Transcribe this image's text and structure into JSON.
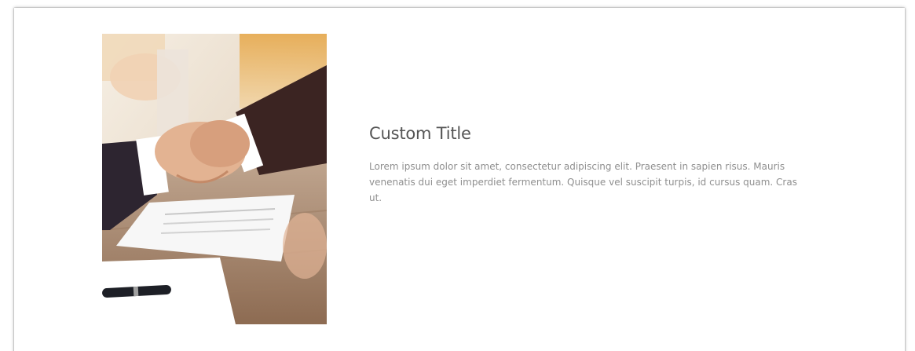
{
  "card": {
    "image_alt": "handshake-over-contract-photo",
    "title": "Custom Title",
    "body": "Lorem ipsum dolor sit amet, consectetur adipiscing elit. Praesent in sapien risus. Mauris venenatis dui eget imperdiet fermentum. Quisque vel suscipit turpis, id cursus quam. Cras ut."
  },
  "colors": {
    "title": "#555555",
    "body": "#8f8f8f",
    "background": "#ffffff"
  }
}
